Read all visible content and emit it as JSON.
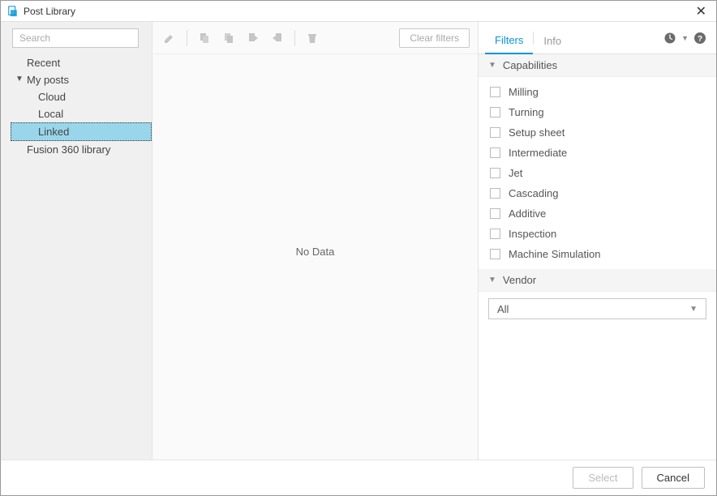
{
  "window": {
    "title": "Post Library"
  },
  "search": {
    "placeholder": "Search"
  },
  "tree": {
    "items": [
      {
        "label": "Recent",
        "level": 0,
        "expandable": false,
        "expanded": false,
        "selected": false
      },
      {
        "label": "My posts",
        "level": 0,
        "expandable": true,
        "expanded": true,
        "selected": false
      },
      {
        "label": "Cloud",
        "level": 1,
        "expandable": false,
        "expanded": false,
        "selected": false
      },
      {
        "label": "Local",
        "level": 1,
        "expandable": false,
        "expanded": false,
        "selected": false
      },
      {
        "label": "Linked",
        "level": 1,
        "expandable": false,
        "expanded": false,
        "selected": true
      },
      {
        "label": "Fusion 360 library",
        "level": 0,
        "expandable": false,
        "expanded": false,
        "selected": false
      }
    ]
  },
  "toolbar": {
    "clear_filters": "Clear filters"
  },
  "main": {
    "nodata": "No Data"
  },
  "right": {
    "tabs": [
      {
        "label": "Filters",
        "active": true
      },
      {
        "label": "Info",
        "active": false
      }
    ],
    "sections": {
      "capabilities": {
        "title": "Capabilities",
        "items": [
          "Milling",
          "Turning",
          "Setup sheet",
          "Intermediate",
          "Jet",
          "Cascading",
          "Additive",
          "Inspection",
          "Machine Simulation"
        ]
      },
      "vendor": {
        "title": "Vendor",
        "selected": "All"
      }
    }
  },
  "footer": {
    "select": "Select",
    "cancel": "Cancel"
  }
}
